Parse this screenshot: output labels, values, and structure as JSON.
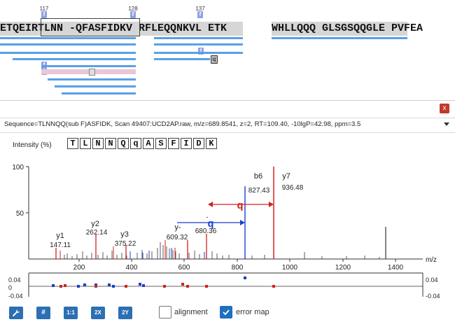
{
  "coverage": {
    "position_labels": [
      "117",
      "128",
      "137"
    ],
    "segments": [
      "ETQEIRTLNN -QFASFIDKV RFLEQQNKVL ETK",
      "WHLLQQQ GLSGSQQGLE PVFEA"
    ],
    "ptm_labels": [
      "f",
      "f",
      "f",
      "f",
      "f",
      "f",
      "q"
    ]
  },
  "info": {
    "text": "Sequence=TLNNQQ(sub F)ASFIDK, Scan 49407:UCD2AP.raw, m/z=689.8541, z=2, RT=109.40, -10lgP=42.98, ppm=3.5",
    "close_label": "x"
  },
  "spectrum": {
    "intensity_label": "Intensity (%)",
    "residues": [
      "T",
      "L",
      "N",
      "N",
      "Q",
      "q",
      "A",
      "S",
      "F",
      "I",
      "D",
      "K"
    ],
    "yticks": [
      "100",
      "50"
    ],
    "xticks": [
      "200",
      "400",
      "600",
      "800",
      "1000",
      "1200",
      "1400"
    ],
    "xlabel": "m/z",
    "error_ticks_left": [
      "0.04",
      "0",
      "-0.04"
    ],
    "error_ticks_right": [
      "0.04",
      "-0.04"
    ],
    "annotations": [
      {
        "name": "y1",
        "mz": "147.11"
      },
      {
        "name": "y2",
        "mz": "262.14"
      },
      {
        "name": "y3",
        "mz": "375.22"
      },
      {
        "name": "y-",
        "mz": "609.32"
      },
      {
        "name": "-",
        "mz": "680.36"
      },
      {
        "name": "b6",
        "mz": "827.43"
      },
      {
        "name": "y7",
        "mz": "936.48"
      }
    ],
    "gap_residue_red": "q",
    "gap_residue_blue": "q"
  },
  "toolbar": {
    "buttons": [
      "#",
      "1:1",
      "2X",
      "2Y"
    ],
    "alignment_label": "alignment",
    "alignment_checked": false,
    "error_map_label": "error map",
    "error_map_checked": true
  },
  "colors": {
    "peptide": "#5a9fe6",
    "ptm": "#8fa0ea",
    "b_ion": "#1a3fcf",
    "y_ion": "#d32020",
    "accent_button": "#2c6fb3",
    "close": "#c0392b"
  }
}
